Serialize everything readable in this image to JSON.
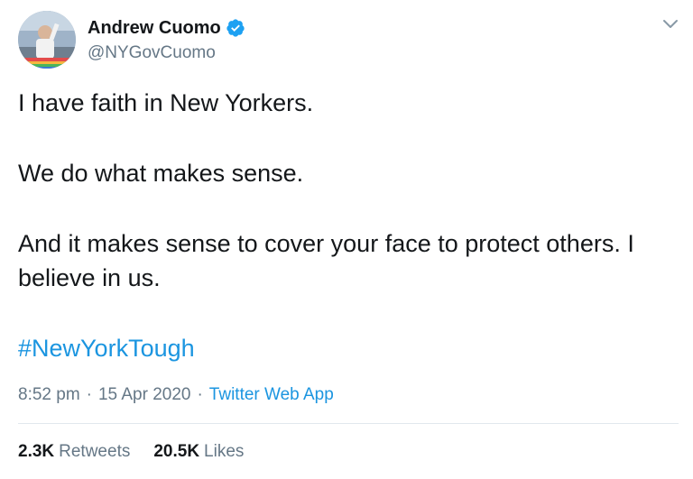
{
  "author": {
    "display_name": "Andrew Cuomo",
    "handle": "@NYGovCuomo",
    "verified": true
  },
  "tweet": {
    "paragraphs": [
      "I have faith in New Yorkers.",
      "We do what makes sense.",
      "And it makes sense to cover your face to protect others. I believe in us."
    ],
    "hashtag": "#NewYorkTough",
    "time": "8:52 pm",
    "date": "15 Apr 2020",
    "separator": "·",
    "source": "Twitter Web App"
  },
  "stats": {
    "retweets_count": "2.3K",
    "retweets_label": "Retweets",
    "likes_count": "20.5K",
    "likes_label": "Likes"
  },
  "icons": {
    "verified": "verified-badge-icon",
    "menu": "chevron-down-icon"
  },
  "colors": {
    "link": "#1b95e0",
    "secondary_text": "#657786",
    "primary_text": "#14171a",
    "divider": "#e1e8ed"
  }
}
